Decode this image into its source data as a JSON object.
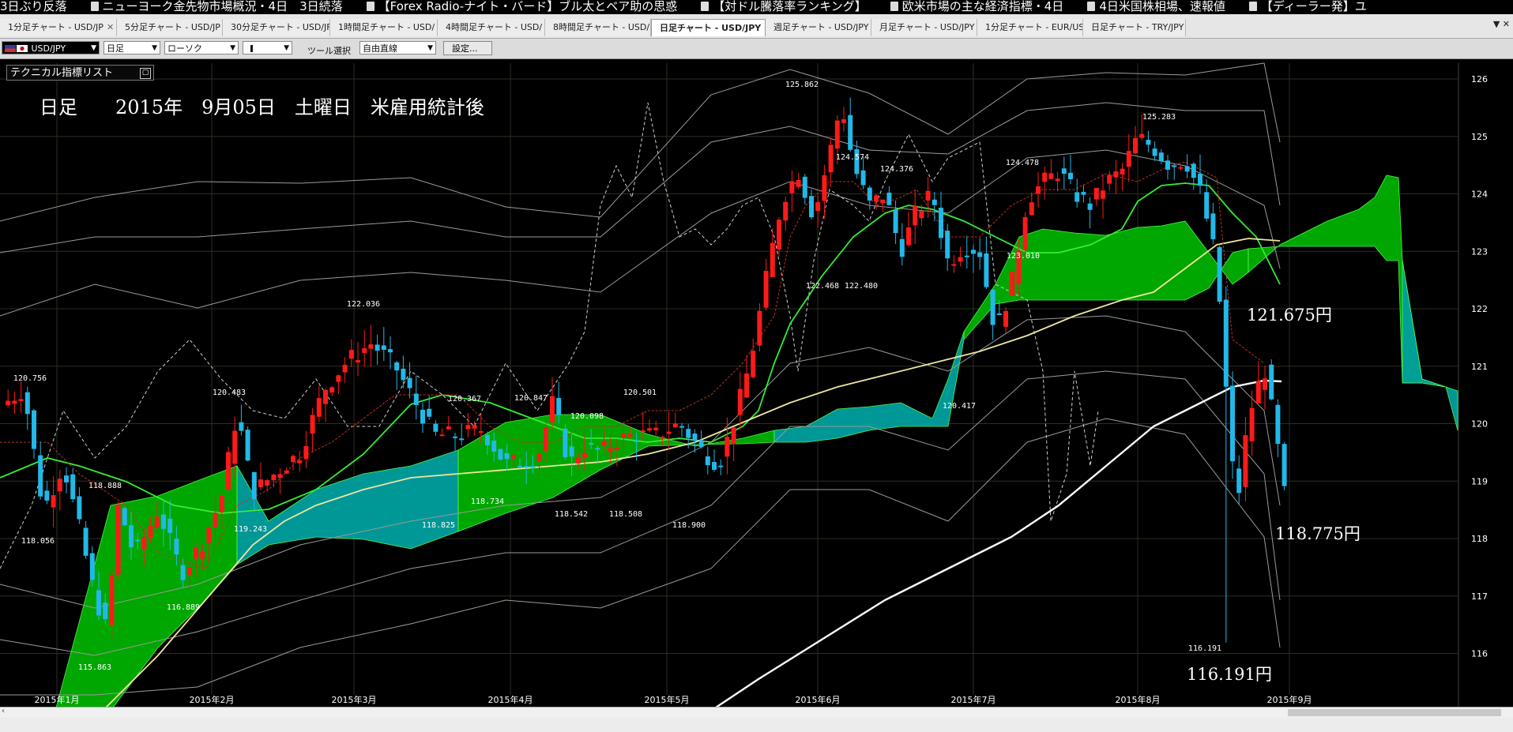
{
  "news": [
    "3日ぶり反落",
    "ニューヨーク金先物市場概況・4日　3日続落",
    "【Forex Radio-ナイト・バード】ブル太とベア助の思惑",
    "【対ドル騰落率ランキング】",
    "欧米市場の主な経済指標・4日",
    "4日米国株相場、速報値",
    "【ディーラー発】ユ"
  ],
  "tabs": [
    "1分足チャート - USD/JP",
    "5分足チャート - USD/JP",
    "30分足チャート - USD/JF",
    "1時間足チャート - USD/",
    "4時間足チャート - USD/",
    "8時間足チャート - USD/",
    "日足チャート - USD/JPY",
    "週足チャート - USD/JPY",
    "月足チャート - USD/JPY",
    "1分足チャート - EUR/US",
    "日足チャート - TRY/JPY"
  ],
  "active_tab": 6,
  "toolbar": {
    "pair": "USD/JPY",
    "timeframe": "日足",
    "chart_type": "ローソク",
    "tool_label": "ツール選択",
    "tool_value": "自由直線",
    "settings": "設定..."
  },
  "tech_list_label": "テクニカル指標リスト",
  "caption": "日足　　2015年　9月05日　土曜日　米雇用統計後",
  "annotations": {
    "high": "121.675円",
    "close": "118.775円",
    "low": "116.191円"
  },
  "colors": {
    "background": "#000000",
    "bull": "#ff1a1a",
    "bear": "#22b8e8",
    "cloud_up": "#00b000",
    "cloud_down": "#00a0a0",
    "kijun": "#33ee33",
    "ma_short": "#f0e6a0",
    "ma_long": "#ffffff"
  },
  "chart_data": {
    "type": "candlestick",
    "symbol": "USD/JPY",
    "timeframe": "日足",
    "ylim": [
      115.8,
      126.2
    ],
    "yticks": [
      116,
      117,
      118,
      119,
      120,
      121,
      122,
      123,
      124,
      125,
      126
    ],
    "x_dates": [
      "2015年1月",
      "2015年2月",
      "2015年3月",
      "2015年4月",
      "2015年5月",
      "2015年6月",
      "2015年7月",
      "2015年8月",
      "2015年9月"
    ],
    "grid": true,
    "price_labels": [
      "120.756",
      "118.056",
      "115.863",
      "118.888",
      "116.889",
      "120.483",
      "119.243",
      "122.036",
      "120.367",
      "118.825",
      "118.734",
      "120.847",
      "118.542",
      "120.098",
      "118.508",
      "120.501",
      "118.900",
      "125.862",
      "124.574",
      "122.468",
      "122.480",
      "124.376",
      "120.417",
      "124.478",
      "123.010",
      "125.283",
      "116.191"
    ],
    "key_levels": {
      "high": 121.675,
      "close": 118.775,
      "low": 116.191
    }
  }
}
